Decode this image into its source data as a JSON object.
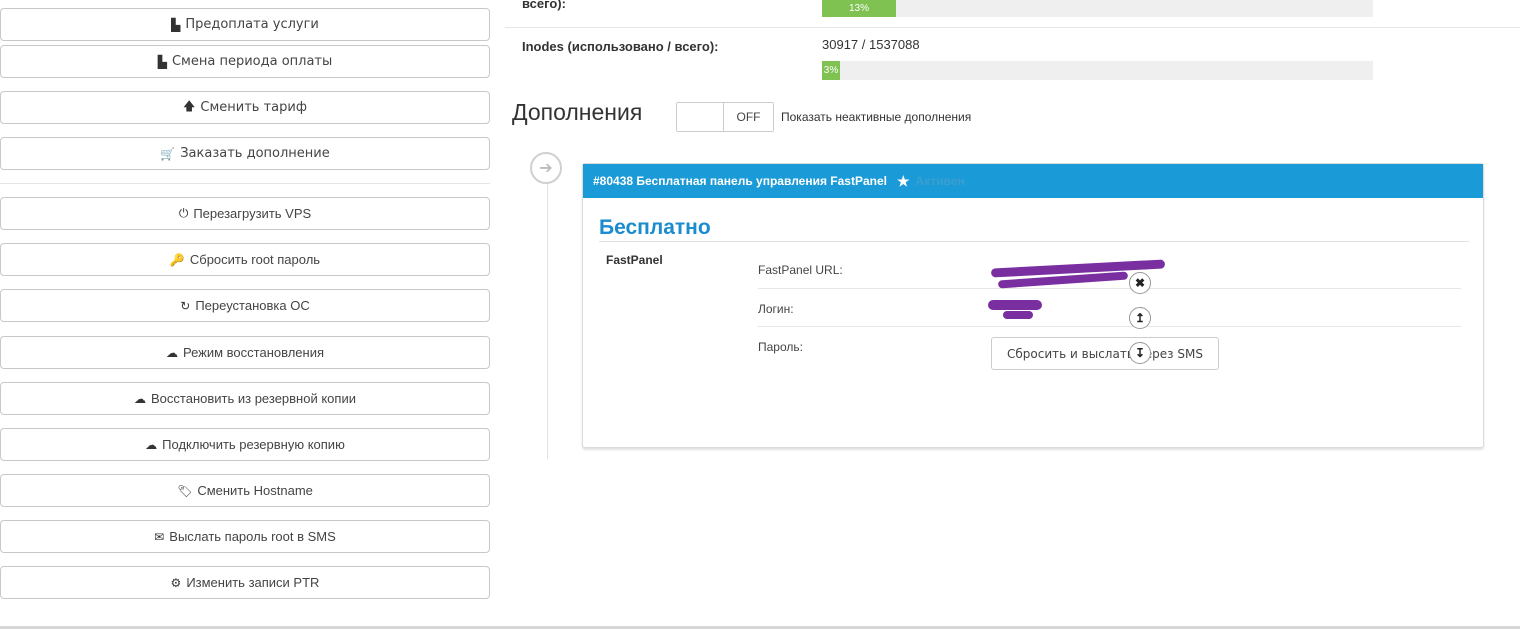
{
  "sidebar": {
    "items": [
      {
        "label": "Предоплата услуги",
        "icon": "file-icon",
        "glyph": "▙"
      },
      {
        "label": "Смена периода оплаты",
        "icon": "file-icon",
        "glyph": "▙"
      },
      {
        "label": "Сменить тариф",
        "icon": "arrow-up-icon",
        "glyph": "🡅"
      },
      {
        "label": "Заказать дополнение",
        "icon": "cart-icon",
        "glyph": "🛒"
      },
      {
        "label": "Перезагрузить VPS",
        "icon": "power-icon",
        "glyph": "⏻"
      },
      {
        "label": "Сбросить root пароль",
        "icon": "key-icon",
        "glyph": "🔑"
      },
      {
        "label": "Переустановка ОС",
        "icon": "refresh-icon",
        "glyph": "↻"
      },
      {
        "label": "Режим восстановления",
        "icon": "cloud-upload-icon",
        "glyph": "☁"
      },
      {
        "label": "Восстановить из резервной копии",
        "icon": "cloud-upload-icon",
        "glyph": "☁"
      },
      {
        "label": "Подключить резервную копию",
        "icon": "cloud-upload-icon",
        "glyph": "☁"
      },
      {
        "label": "Сменить Hostname",
        "icon": "tag-icon",
        "glyph": "🏷"
      },
      {
        "label": "Выслать пароль root в SMS",
        "icon": "envelope-icon",
        "glyph": "✉"
      },
      {
        "label": "Изменить записи PTR",
        "icon": "gear-icon",
        "glyph": "⚙"
      }
    ]
  },
  "stats": {
    "disk_label_tail": "всего):",
    "disk_percent": "13%",
    "disk_fraction": 0.13,
    "inodes_label": "Inodes (использовано / всего):",
    "inodes_value": "30917 / 1537088",
    "inodes_percent": "3%",
    "inodes_fraction": 0.03
  },
  "addons": {
    "title": "Дополнения",
    "toggle_state": "OFF",
    "show_inactive_label": "Показать неактивные дополнения",
    "panel": {
      "header": "#80438 Бесплатная панель управления FastPanel",
      "status": "Активен",
      "price": "Бесплатно",
      "product": "FastPanel",
      "rows": {
        "url_label": "FastPanel URL:",
        "login_label": "Логин:",
        "password_label": "Пароль:"
      },
      "reset_button": "Сбросить и выслать через SMS"
    }
  }
}
